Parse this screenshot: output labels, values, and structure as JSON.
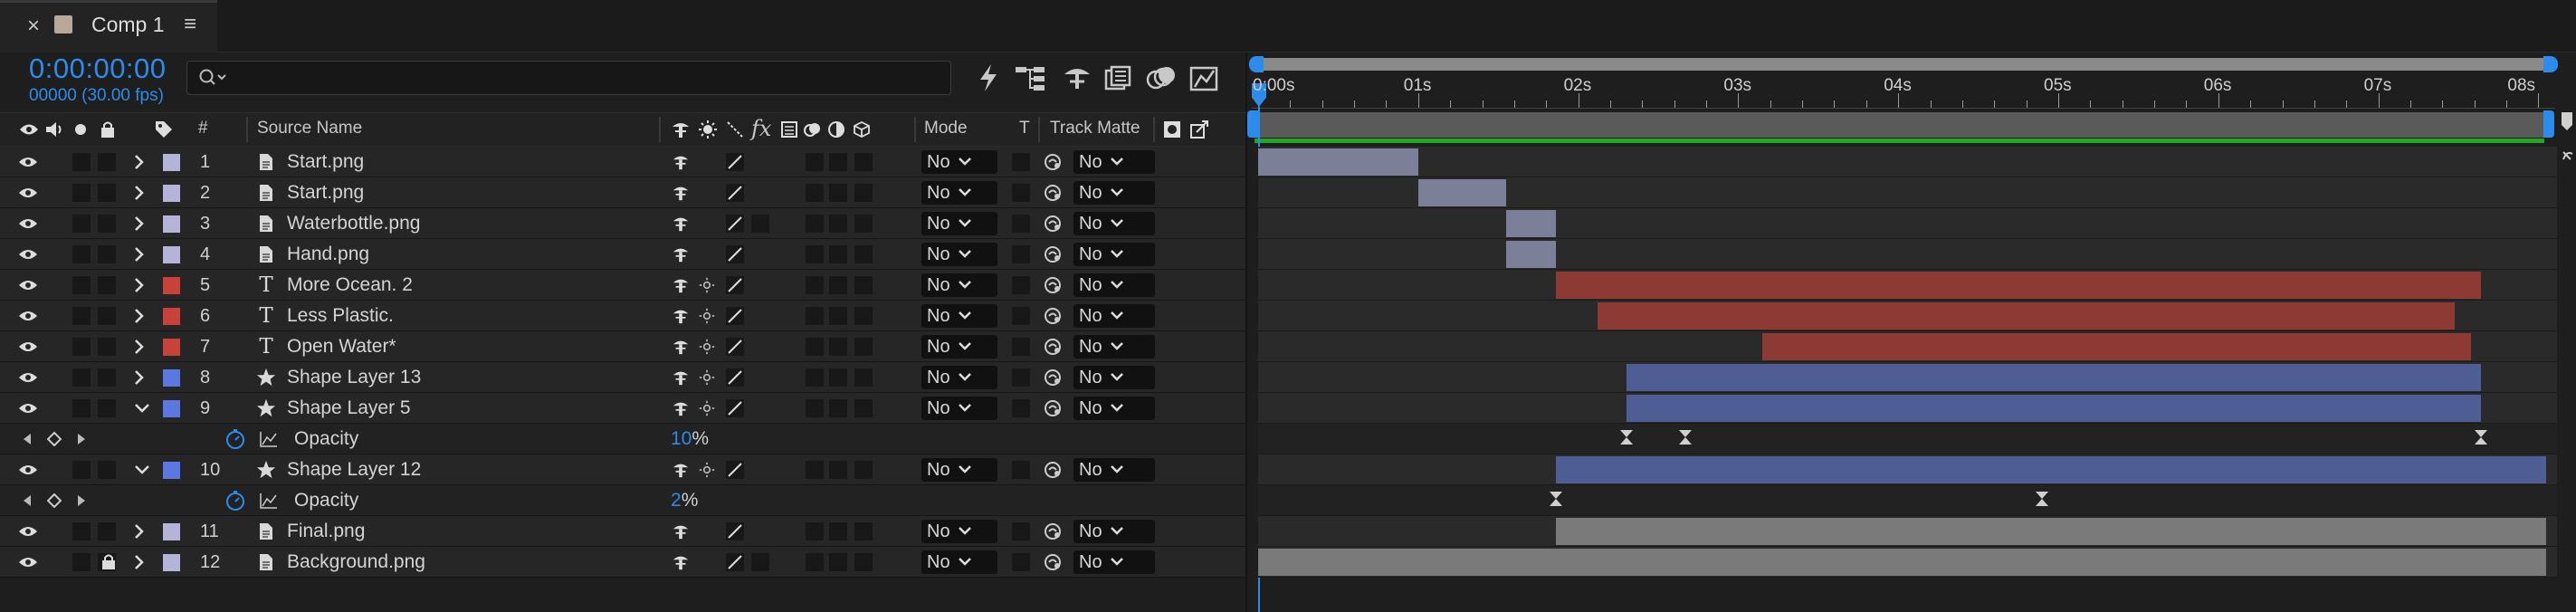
{
  "tab": {
    "close": "×",
    "title": "Comp 1",
    "menu": "≡"
  },
  "timecode": "0:00:00:00",
  "framecount": "00000 (30.00 fps)",
  "search": {
    "placeholder": ""
  },
  "headers": {
    "hash": "#",
    "source_name": "Source Name",
    "mode": "Mode",
    "t": "T",
    "track_matte": "Track Matte",
    "fx": "fx"
  },
  "ruler": [
    "0:00s",
    "01s",
    "02s",
    "03s",
    "04s",
    "05s",
    "06s",
    "07s",
    "08s"
  ],
  "layers": [
    {
      "num": "1",
      "name": "Start.png",
      "type": "file",
      "color": "#b4b4d8",
      "mode": "No",
      "matte": "No",
      "bar_color": "#7c7f98",
      "start": 0.0,
      "end": 1.0,
      "expanded": false,
      "lock": false,
      "has_sun": false,
      "extra_box": false
    },
    {
      "num": "2",
      "name": "Start.png",
      "type": "file",
      "color": "#b4b4d8",
      "mode": "No",
      "matte": "No",
      "bar_color": "#7c7f98",
      "start": 1.0,
      "end": 1.55,
      "expanded": false,
      "lock": false,
      "has_sun": false,
      "extra_box": false
    },
    {
      "num": "3",
      "name": "Waterbottle.png",
      "type": "file",
      "color": "#b4b4d8",
      "mode": "No",
      "matte": "No",
      "bar_color": "#7c7f98",
      "start": 1.55,
      "end": 1.86,
      "expanded": false,
      "lock": false,
      "has_sun": false,
      "extra_box": true
    },
    {
      "num": "4",
      "name": "Hand.png",
      "type": "file",
      "color": "#b4b4d8",
      "mode": "No",
      "matte": "No",
      "bar_color": "#7c7f98",
      "start": 1.55,
      "end": 1.86,
      "expanded": false,
      "lock": false,
      "has_sun": false,
      "extra_box": false
    },
    {
      "num": "5",
      "name": "More Ocean. 2",
      "type": "text",
      "color": "#c9423a",
      "mode": "No",
      "matte": "No",
      "bar_color": "#8e3a34",
      "start": 1.86,
      "end": 7.64,
      "expanded": false,
      "lock": false,
      "has_sun": true,
      "extra_box": false
    },
    {
      "num": "6",
      "name": "Less Plastic.",
      "type": "text",
      "color": "#c9423a",
      "mode": "No",
      "matte": "No",
      "bar_color": "#8e3a34",
      "start": 2.12,
      "end": 7.48,
      "expanded": false,
      "lock": false,
      "has_sun": true,
      "extra_box": false
    },
    {
      "num": "7",
      "name": "Open Water*",
      "type": "text",
      "color": "#c9423a",
      "mode": "No",
      "matte": "No",
      "bar_color": "#8e3a34",
      "start": 3.15,
      "end": 7.58,
      "expanded": false,
      "lock": false,
      "has_sun": true,
      "extra_box": false
    },
    {
      "num": "8",
      "name": "Shape Layer 13",
      "type": "shape",
      "color": "#5a78e0",
      "mode": "No",
      "matte": "No",
      "bar_color": "#4e5d94",
      "start": 2.3,
      "end": 7.64,
      "expanded": false,
      "lock": false,
      "has_sun": true,
      "extra_box": false
    },
    {
      "num": "9",
      "name": "Shape Layer 5",
      "type": "shape",
      "color": "#5a78e0",
      "mode": "No",
      "matte": "No",
      "bar_color": "#4e5d94",
      "start": 2.3,
      "end": 7.64,
      "expanded": true,
      "lock": false,
      "has_sun": true,
      "extra_box": false,
      "prop": {
        "name": "Opacity",
        "value": "10",
        "unit": "%",
        "keys": [
          2.3,
          2.67,
          7.64
        ]
      }
    },
    {
      "num": "10",
      "name": "Shape Layer 12",
      "type": "shape",
      "color": "#5a78e0",
      "mode": "No",
      "matte": "No",
      "bar_color": "#4e5d94",
      "start": 1.86,
      "end": 8.05,
      "expanded": true,
      "lock": false,
      "has_sun": true,
      "extra_box": false,
      "prop": {
        "name": "Opacity",
        "value": "2",
        "unit": "%",
        "keys": [
          1.86,
          4.9
        ]
      }
    },
    {
      "num": "11",
      "name": "Final.png",
      "type": "file",
      "color": "#b4b4d8",
      "mode": "No",
      "matte": "No",
      "bar_color": "#7a7a7a",
      "start": 1.86,
      "end": 8.05,
      "expanded": false,
      "lock": false,
      "has_sun": false,
      "extra_box": false
    },
    {
      "num": "12",
      "name": "Background.png",
      "type": "file",
      "color": "#b4b4d8",
      "mode": "No",
      "matte": "No",
      "bar_color": "#7a7a7a",
      "start": 0.0,
      "end": 8.05,
      "expanded": false,
      "lock": true,
      "has_sun": false,
      "extra_box": true
    }
  ],
  "icons": {
    "eye": "eye-icon",
    "lock": "lock-icon",
    "twirl": "chevron-icon",
    "stopwatch": "stopwatch-icon",
    "graph": "graph-icon"
  },
  "colors": {
    "accent": "#2d8ceb",
    "green_bar": "#25a524"
  }
}
